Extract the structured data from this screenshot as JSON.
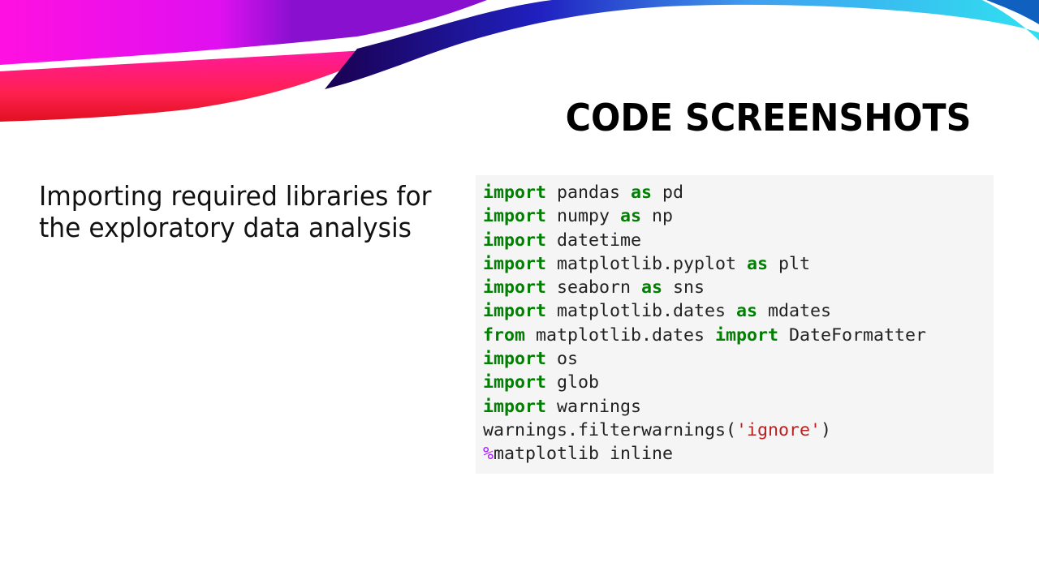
{
  "slide": {
    "title": "CODE SCREENSHOTS",
    "body_text": "Importing required libraries for the exploratory data analysis",
    "colors": {
      "keyword": "#008000",
      "string": "#ba2121",
      "magic": "#aa22ff",
      "code_background": "#f5f5f5"
    }
  },
  "code": {
    "lines": [
      [
        {
          "t": "import",
          "c": "kw"
        },
        {
          "t": " pandas ",
          "c": ""
        },
        {
          "t": "as",
          "c": "kw"
        },
        {
          "t": " pd",
          "c": ""
        }
      ],
      [
        {
          "t": "import",
          "c": "kw"
        },
        {
          "t": " numpy ",
          "c": ""
        },
        {
          "t": "as",
          "c": "kw"
        },
        {
          "t": " np",
          "c": ""
        }
      ],
      [
        {
          "t": "import",
          "c": "kw"
        },
        {
          "t": " datetime",
          "c": ""
        }
      ],
      [
        {
          "t": "import",
          "c": "kw"
        },
        {
          "t": " matplotlib.pyplot ",
          "c": ""
        },
        {
          "t": "as",
          "c": "kw"
        },
        {
          "t": " plt",
          "c": ""
        }
      ],
      [
        {
          "t": "import",
          "c": "kw"
        },
        {
          "t": " seaborn ",
          "c": ""
        },
        {
          "t": "as",
          "c": "kw"
        },
        {
          "t": " sns",
          "c": ""
        }
      ],
      [
        {
          "t": "import",
          "c": "kw"
        },
        {
          "t": " matplotlib.dates ",
          "c": ""
        },
        {
          "t": "as",
          "c": "kw"
        },
        {
          "t": " mdates",
          "c": ""
        }
      ],
      [
        {
          "t": "from",
          "c": "kw"
        },
        {
          "t": " matplotlib.dates ",
          "c": ""
        },
        {
          "t": "import",
          "c": "kw"
        },
        {
          "t": " DateFormatter",
          "c": ""
        }
      ],
      [
        {
          "t": "import",
          "c": "kw"
        },
        {
          "t": " os",
          "c": ""
        }
      ],
      [
        {
          "t": "import",
          "c": "kw"
        },
        {
          "t": " glob",
          "c": ""
        }
      ],
      [
        {
          "t": "import",
          "c": "kw"
        },
        {
          "t": " warnings",
          "c": ""
        }
      ],
      [
        {
          "t": "warnings.filterwarnings(",
          "c": ""
        },
        {
          "t": "'ignore'",
          "c": "str"
        },
        {
          "t": ")",
          "c": ""
        }
      ],
      [
        {
          "t": "%",
          "c": "magic"
        },
        {
          "t": "matplotlib inline",
          "c": ""
        }
      ]
    ]
  }
}
